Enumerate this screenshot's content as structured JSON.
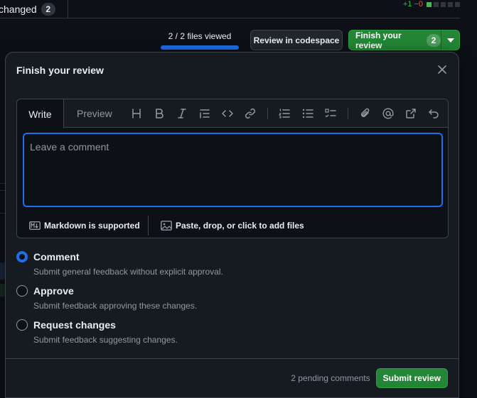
{
  "background": {
    "tab_label": "changed",
    "tab_count": "2",
    "diffstat_add": "+1",
    "diffstat_del": "−0",
    "files_viewed": "2 / 2 files viewed",
    "files_viewed_fraction": 1.0,
    "codespace_button": "Review in codespace",
    "finish_button": "Finish your review",
    "finish_count": "2"
  },
  "dialog": {
    "title": "Finish your review",
    "tabs": {
      "write": "Write",
      "preview": "Preview"
    },
    "toolbar_icons": [
      "heading-icon",
      "bold-icon",
      "italic-icon",
      "quote-icon",
      "code-icon",
      "link-icon",
      "ordered-list-icon",
      "unordered-list-icon",
      "task-list-icon",
      "attach-icon",
      "mention-icon",
      "reference-icon",
      "undo-icon"
    ],
    "comment": {
      "placeholder": "Leave a comment",
      "value": ""
    },
    "markdown_note": "Markdown is supported",
    "attach_note": "Paste, drop, or click to add files",
    "options": [
      {
        "label": "Comment",
        "desc": "Submit general feedback without explicit approval.",
        "selected": true
      },
      {
        "label": "Approve",
        "desc": "Submit feedback approving these changes.",
        "selected": false
      },
      {
        "label": "Request changes",
        "desc": "Submit feedback suggesting changes.",
        "selected": false
      }
    ],
    "pending": "2 pending comments",
    "submit": "Submit review"
  },
  "colors": {
    "accent": "#1f6feb",
    "success": "#238636",
    "bg": "#0d1117",
    "panel": "#161b22"
  }
}
